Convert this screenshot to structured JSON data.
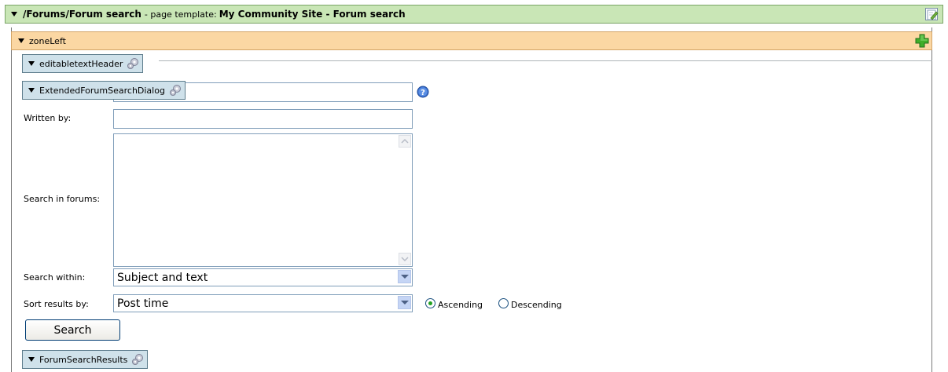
{
  "page": {
    "path": "/Forums/Forum search",
    "template_label": " - page template: ",
    "template_name": "My Community Site - Forum search"
  },
  "zone": {
    "name": "zoneLeft"
  },
  "webparts": {
    "header": "editabletextHeader",
    "dialog": "ExtendedForumSearchDialog",
    "results": "ForumSearchResults"
  },
  "form": {
    "search_text_value": "",
    "written_by_label": "Written by:",
    "written_by_value": "",
    "search_in_forums_label": "Search in forums:",
    "search_within_label": "Search within:",
    "search_within_value": "Subject and text",
    "sort_results_label": "Sort results by:",
    "sort_results_value": "Post time",
    "ascending_label": "Ascending",
    "descending_label": "Descending",
    "sort_order_selected": "Ascending",
    "search_button": "Search"
  },
  "icons": {
    "page_edit": "edit-page-icon",
    "zone_add": "add-webpart-icon",
    "webpart_settings": "gear-icon",
    "help": "help-icon"
  },
  "colors": {
    "page_header_bg": "#c9e6b6",
    "zone_header_bg": "#fbd7a3",
    "webpart_header_bg": "#cfe1ea",
    "radio_selected": "#21a121"
  }
}
